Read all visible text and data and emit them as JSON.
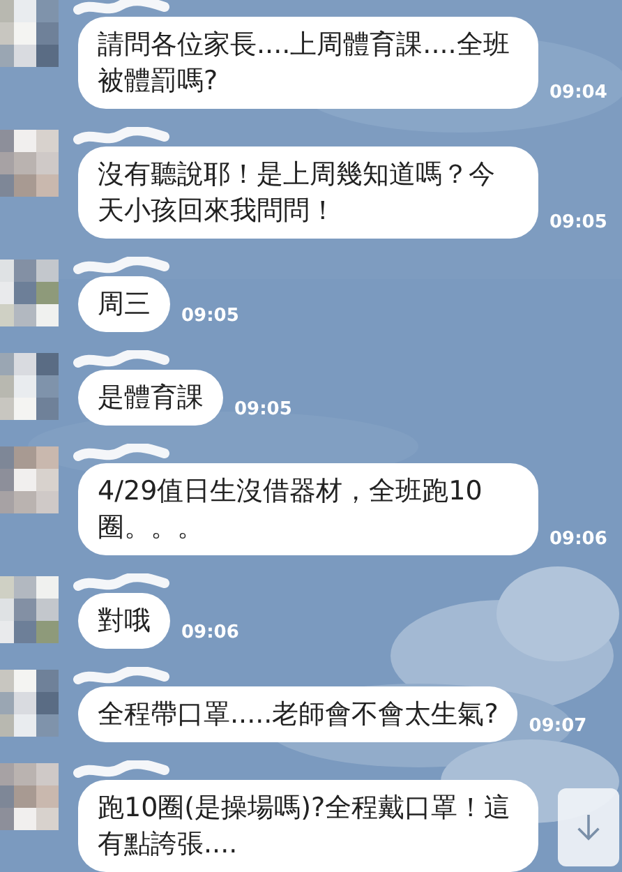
{
  "messages": [
    {
      "text": "請問各位家長....上周體育課....全班被體罰嗎?",
      "time": "09:04"
    },
    {
      "text": "沒有聽說耶！是上周幾知道嗎？今天小孩回來我問問！",
      "time": "09:05"
    },
    {
      "text": "周三",
      "time": "09:05"
    },
    {
      "text": "是體育課",
      "time": "09:05"
    },
    {
      "text": "4/29值日生沒借器材，全班跑10圈。。。",
      "time": "09:06"
    },
    {
      "text": "對哦",
      "time": "09:06"
    },
    {
      "text": "全程帶口罩.....老師會不會太生氣?",
      "time": "09:07"
    },
    {
      "text": "跑10圈(是操場嗎)?全程戴口罩！這有點誇張...."
    }
  ]
}
